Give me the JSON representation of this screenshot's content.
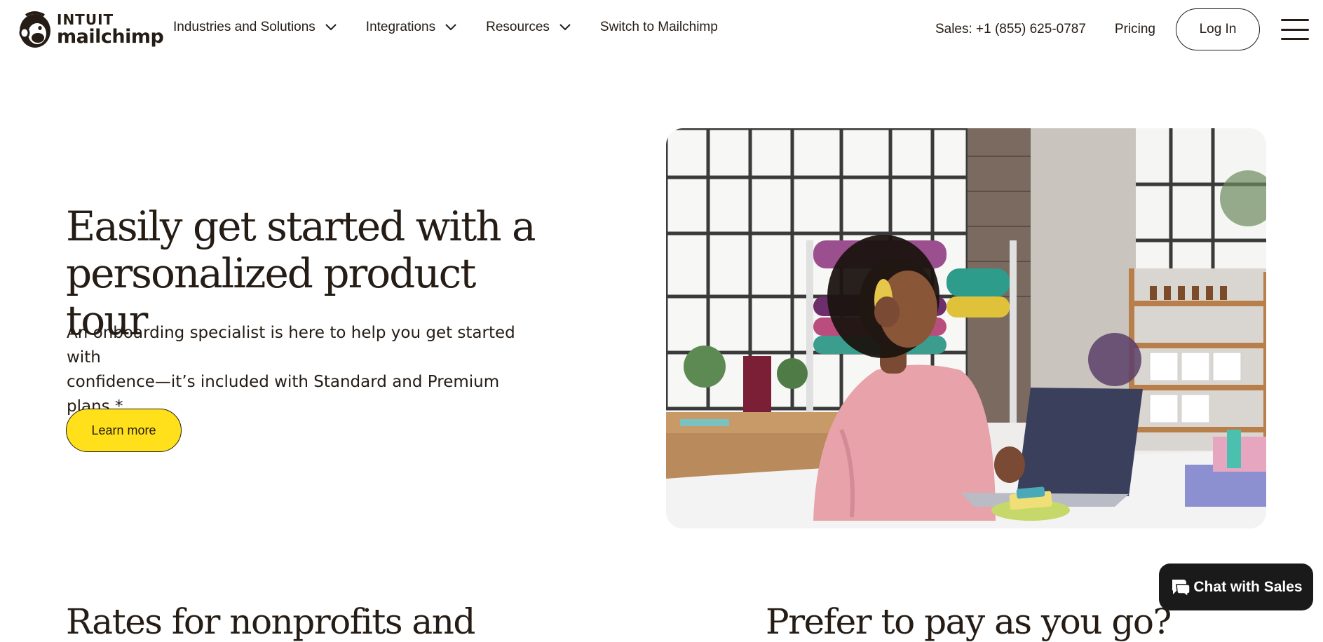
{
  "header": {
    "logo": {
      "line1": "INTUIT",
      "line2": "mailchimp"
    },
    "nav": [
      {
        "label": "Industries and Solutions",
        "icon": "chevron-down-icon"
      },
      {
        "label": "Integrations",
        "icon": "chevron-down-icon"
      },
      {
        "label": "Resources",
        "icon": "chevron-down-icon"
      },
      {
        "label": "Switch to Mailchimp"
      }
    ],
    "sales": "Sales: +1 (855) 625-0787",
    "pricing": "Pricing",
    "login": "Log In",
    "menu_icon": "hamburger-menu-icon"
  },
  "hero": {
    "title_line1": "Easily get started with a",
    "title_line2": "personalized product tour",
    "subtitle_line1": "An onboarding specialist is here to help you get started with",
    "subtitle_line2": "confidence—it’s included with Standard and Premium plans.*",
    "cta": "Learn more"
  },
  "lower": {
    "left_heading": "Rates for nonprofits and",
    "right_heading": "Prefer to pay as you go?"
  },
  "chat": {
    "label": "Chat with Sales",
    "icon": "chat-bubbles-icon"
  },
  "colors": {
    "accent_yellow": "#ffe01b",
    "text_dark": "#241c15",
    "chat_bg": "#1a1a1a"
  }
}
